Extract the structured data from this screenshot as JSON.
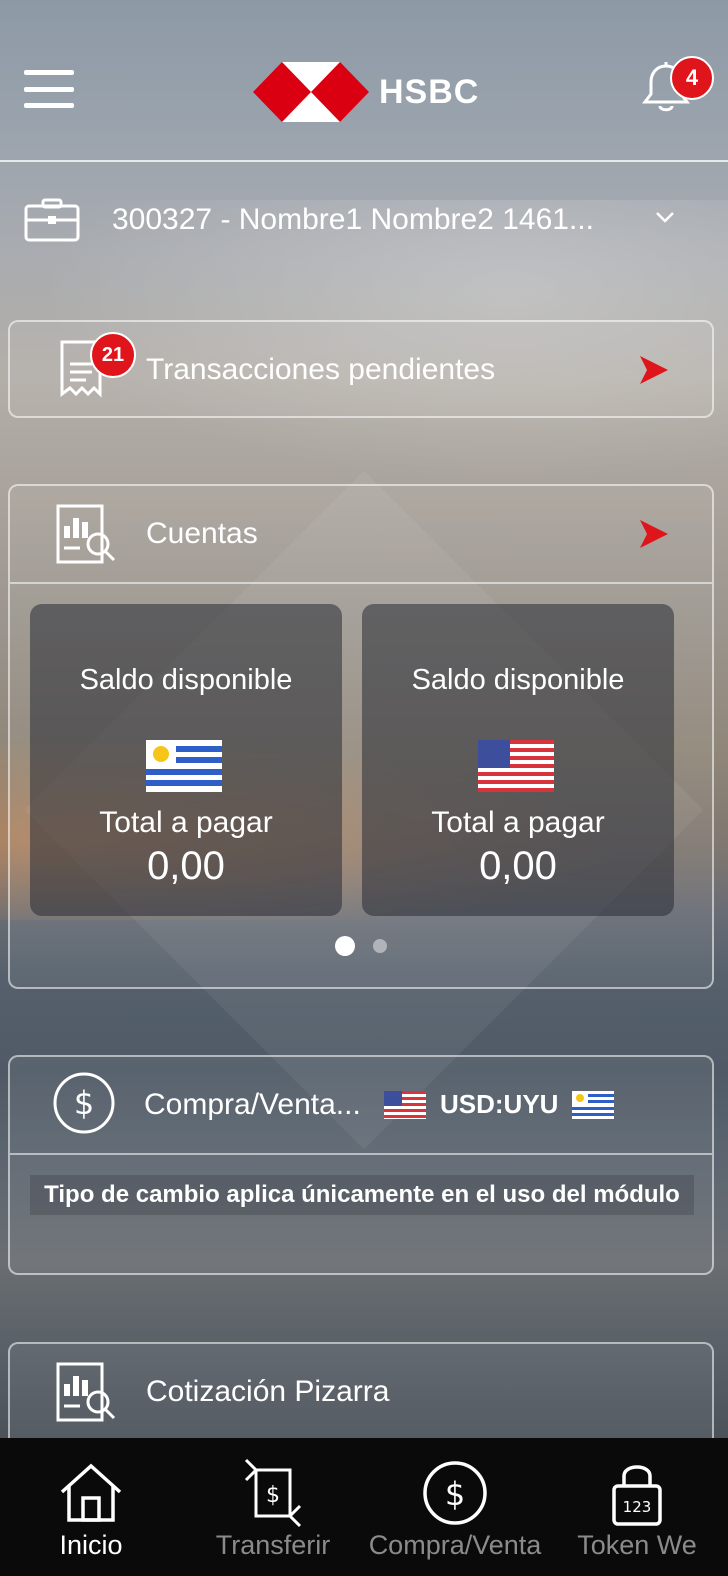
{
  "header": {
    "brand": "HSBC",
    "notifications_count": "4",
    "icons": {
      "menu": "hamburger-menu-icon",
      "bell": "bell-icon",
      "logo": "hsbc-hexagon-logo"
    }
  },
  "account": {
    "label": "300327 - Nombre1 Nombre2 1461...",
    "icons": {
      "left": "briefcase-icon",
      "right": "chevron-down-icon"
    }
  },
  "pending": {
    "label": "Transacciones pendientes",
    "badge": "21",
    "icon": "receipt-icon"
  },
  "cuentas": {
    "label": "Cuentas",
    "icon": "report-icon",
    "balances": [
      {
        "title": "Saldo disponible",
        "flag": "uruguay-flag-icon",
        "subtitle": "Total a pagar",
        "amount": "0,00"
      },
      {
        "title": "Saldo disponible",
        "flag": "usa-flag-icon",
        "subtitle": "Total a pagar",
        "amount": "0,00"
      }
    ],
    "pager": {
      "pages": 2,
      "current": 1
    }
  },
  "compra": {
    "label": "Compra/Venta...",
    "pair": "USD:UYU",
    "note": "Tipo de cambio aplica únicamente en el uso del módulo",
    "icon": "dollar-circle-icon"
  },
  "cotizacion": {
    "label": "Cotización Pizarra",
    "icon": "report-icon"
  },
  "bottom_nav": [
    {
      "label": "Inicio",
      "icon": "home-icon",
      "active": true
    },
    {
      "label": "Transferir",
      "icon": "transfer-icon",
      "active": false
    },
    {
      "label": "Compra/Venta",
      "icon": "dollar-circle-icon",
      "active": false
    },
    {
      "label": "Token We",
      "icon": "lock-icon",
      "active": false
    }
  ],
  "colors": {
    "accent": "#e0151b",
    "nav_bg": "#0a0a0a",
    "nav_inactive": "#8b8b8b"
  }
}
